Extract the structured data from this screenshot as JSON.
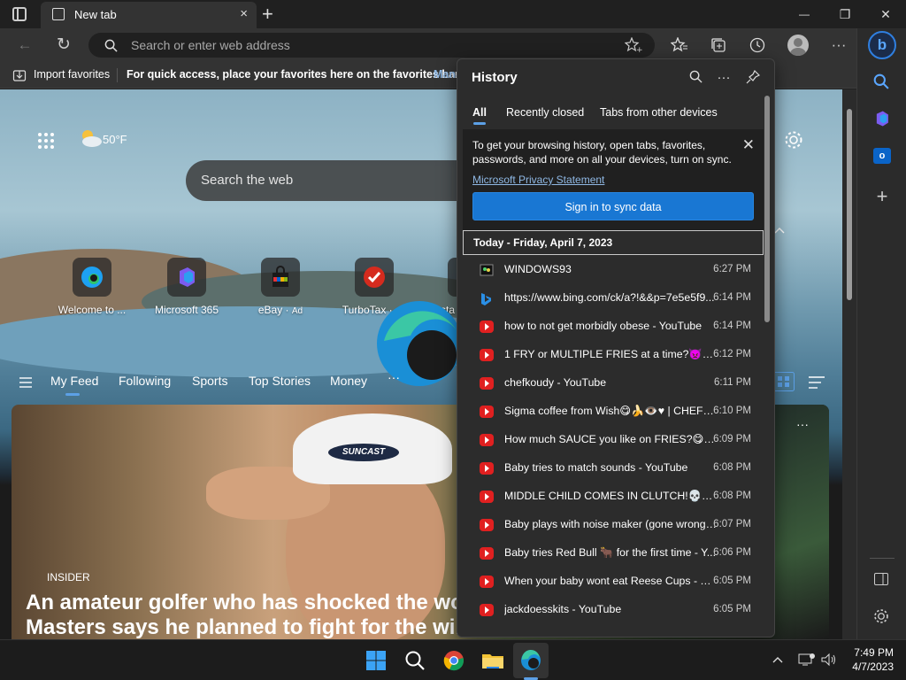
{
  "tab": {
    "label": "New tab",
    "close": "×",
    "new": "+"
  },
  "window": {
    "minimize": "—",
    "restore": "❐",
    "close": "✕"
  },
  "toolbar": {
    "back": "←",
    "refresh": "↻",
    "address_placeholder": "Search or enter web address",
    "more": "···"
  },
  "favorites_bar": {
    "import_label": "Import favorites",
    "hint": "For quick access, place your favorites here on the favorites bar.",
    "manage_label": "Mana"
  },
  "newtab": {
    "weather": "50°F",
    "search_placeholder": "Search the web",
    "tiles": [
      {
        "label": "Welcome to ..."
      },
      {
        "label": "Microsoft 365"
      },
      {
        "label": "eBay",
        "ad": "Ad"
      },
      {
        "label": "TurboTax",
        "ad": "Ad"
      },
      {
        "label": "Insta"
      }
    ],
    "feed": [
      "My Feed",
      "Following",
      "Sports",
      "Top Stories",
      "Money",
      "···"
    ],
    "hero": {
      "source": "INSIDER",
      "title_line1": "An amateur golfer who has shocked the worl",
      "title_line2": "Masters says he planned to fight for the win",
      "cap_text": "SUNCAST"
    }
  },
  "history": {
    "title": "History",
    "tabs": [
      "All",
      "Recently closed",
      "Tabs from other devices"
    ],
    "sync_message": "To get your browsing history, open tabs, favorites, passwords, and more on all your devices, turn on sync.",
    "privacy_link": "Microsoft Privacy Statement",
    "sync_button": "Sign in to sync data",
    "date_header": "Today - Friday, April 7, 2023",
    "entries": [
      {
        "title": "WINDOWS93",
        "time": "6:27 PM",
        "icon": "windows93-icon"
      },
      {
        "title": "https://www.bing.com/ck/a?!&&p=7e5e5f9...",
        "time": "6:14 PM",
        "icon": "bing-icon"
      },
      {
        "title": "how to not get morbidly obese - YouTube",
        "time": "6:14 PM",
        "icon": "youtube-icon"
      },
      {
        "title": "1 FRY or MULTIPLE FRIES at a time?👿🔥 ...",
        "time": "6:12 PM",
        "icon": "youtube-icon"
      },
      {
        "title": "chefkoudy - YouTube",
        "time": "6:11 PM",
        "icon": "youtube-icon"
      },
      {
        "title": "Sigma coffee from Wish😋🍌👁️♥ | CHEFK...",
        "time": "6:10 PM",
        "icon": "youtube-icon"
      },
      {
        "title": "How much SAUCE you like on FRIES?😋🍌 ...",
        "time": "6:09 PM",
        "icon": "youtube-icon"
      },
      {
        "title": "Baby tries to match sounds - YouTube",
        "time": "6:08 PM",
        "icon": "youtube-icon"
      },
      {
        "title": "MIDDLE CHILD COMES IN CLUTCH!💀😂 ...",
        "time": "6:08 PM",
        "icon": "youtube-icon"
      },
      {
        "title": "Baby plays with noise maker (gone wrong) ...",
        "time": "6:07 PM",
        "icon": "youtube-icon"
      },
      {
        "title": "Baby tries Red Bull 🐂 for the first time - Y...",
        "time": "6:06 PM",
        "icon": "youtube-icon"
      },
      {
        "title": "When your baby wont eat Reese Cups - Yo...",
        "time": "6:05 PM",
        "icon": "youtube-icon"
      },
      {
        "title": "jackdoesskits - YouTube",
        "time": "6:05 PM",
        "icon": "youtube-icon"
      }
    ]
  },
  "taskbar": {
    "time": "7:49 PM",
    "date": "4/7/2023"
  },
  "colors": {
    "accent": "#1977d3",
    "link": "#8fb8e4",
    "youtube": "#e02020"
  }
}
